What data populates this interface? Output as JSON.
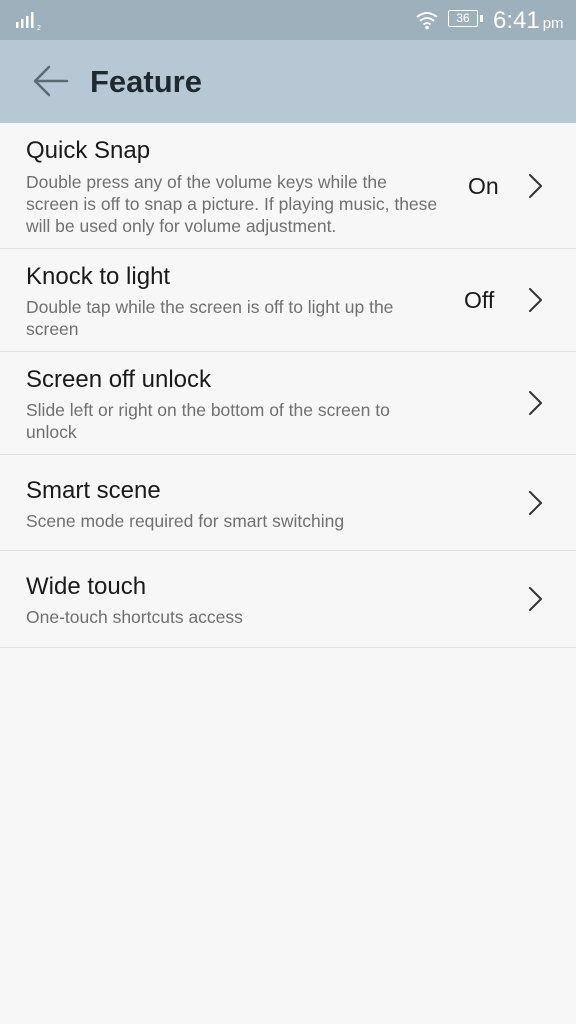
{
  "status_bar": {
    "signal_sim": "2",
    "battery_level": "36",
    "time": "6:41",
    "ampm": "pm"
  },
  "app_bar": {
    "title": "Feature"
  },
  "items": [
    {
      "title": "Quick Snap",
      "description": "Double press any of the volume keys while the screen is off to snap a picture. If playing music, these will be used only for volume adjustment.",
      "value": "On"
    },
    {
      "title": "Knock to light",
      "description": "Double tap while the screen is off to light up the screen",
      "value": "Off"
    },
    {
      "title": "Screen off unlock",
      "description": "Slide left or right on the bottom of the screen to unlock"
    },
    {
      "title": "Smart scene",
      "description": "Scene mode required for smart switching"
    },
    {
      "title": "Wide touch",
      "description": "One-touch shortcuts access"
    }
  ]
}
